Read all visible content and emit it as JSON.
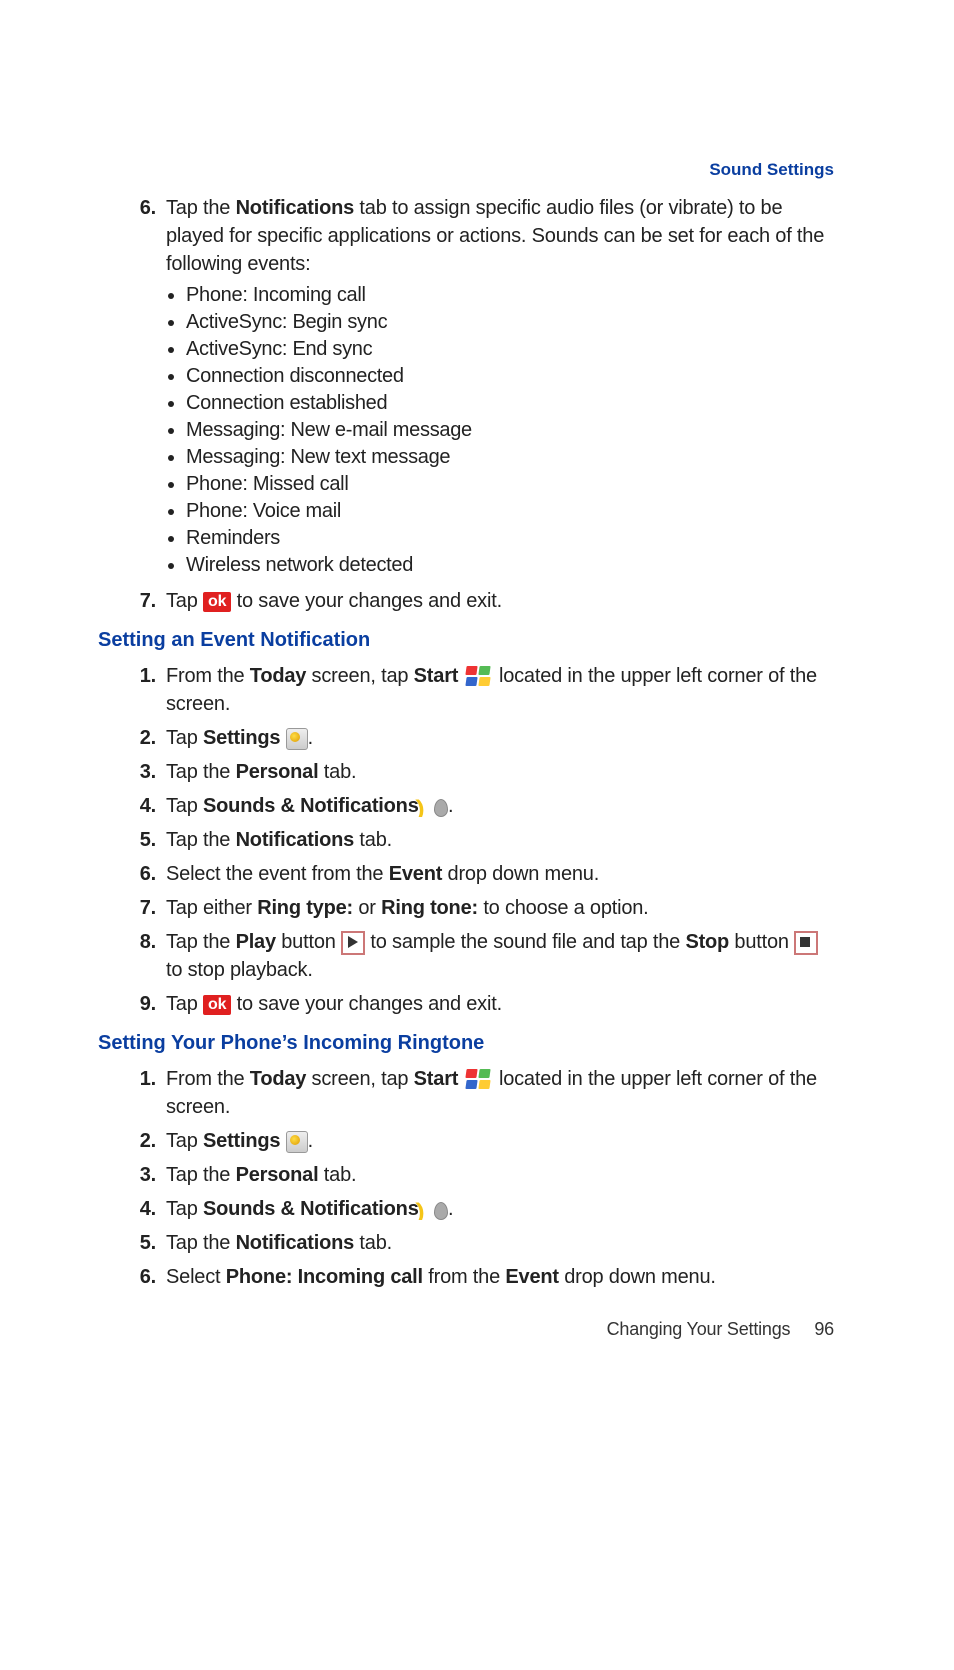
{
  "header": "Sound Settings",
  "top_steps": {
    "s6_num": "6.",
    "s6_part1": "Tap the ",
    "s6_bold1": "Notifications",
    "s6_part2": " tab to assign specific audio files (or vibrate) to be played for specific applications or actions. Sounds can be set for each of the following events:",
    "bullets": [
      "Phone: Incoming call",
      "ActiveSync: Begin sync",
      "ActiveSync: End sync",
      "Connection disconnected",
      "Connection established",
      "Messaging: New e-mail message",
      "Messaging: New text message",
      "Phone: Missed call",
      "Phone: Voice mail",
      "Reminders",
      "Wireless network detected"
    ],
    "s7_num": "7.",
    "s7_part1": "Tap ",
    "s7_ok": "ok",
    "s7_part2": " to save your changes and exit."
  },
  "heading1": "Setting an Event Notification",
  "ev": {
    "s1_num": "1.",
    "s1_a": "From the ",
    "s1_b1": "Today",
    "s1_b": " screen, tap ",
    "s1_b2": "Start",
    "s1_c": " located in the upper left corner of the screen.",
    "s2_num": "2.",
    "s2_a": "Tap ",
    "s2_b": "Settings",
    "s2_c": ".",
    "s3_num": "3.",
    "s3_a": "Tap the ",
    "s3_b": "Personal",
    "s3_c": " tab.",
    "s4_num": "4.",
    "s4_a": "Tap ",
    "s4_b": "Sounds & Notifications",
    "s4_c": ".",
    "s5_num": "5.",
    "s5_a": "Tap the ",
    "s5_b": "Notifications",
    "s5_c": " tab.",
    "s6_num": "6.",
    "s6_a": "Select the event from the ",
    "s6_b": "Event",
    "s6_c": " drop down menu.",
    "s7_num": "7.",
    "s7_a": "Tap either ",
    "s7_b1": "Ring type:",
    "s7_b": " or ",
    "s7_b2": "Ring tone:",
    "s7_c": " to choose a option.",
    "s8_num": "8.",
    "s8_a": " Tap the ",
    "s8_b1": "Play",
    "s8_b": " button ",
    "s8_c": " to sample the sound file and tap the ",
    "s8_b2": "Stop",
    "s8_d": " button ",
    "s8_e": " to stop playback.",
    "s9_num": "9.",
    "s9_a": "Tap ",
    "s9_ok": "ok",
    "s9_b": " to save your changes and exit."
  },
  "heading2": "Setting Your Phone’s Incoming Ringtone",
  "rt": {
    "s1_num": "1.",
    "s1_a": "From the ",
    "s1_b1": "Today",
    "s1_b": " screen, tap ",
    "s1_b2": "Start",
    "s1_c": " located in the upper left corner of the screen.",
    "s2_num": "2.",
    "s2_a": "Tap ",
    "s2_b": "Settings",
    "s2_c": ".",
    "s3_num": "3.",
    "s3_a": "Tap the ",
    "s3_b": "Personal",
    "s3_c": " tab.",
    "s4_num": "4.",
    "s4_a": "Tap ",
    "s4_b": "Sounds & Notifications",
    "s4_c": ".",
    "s5_num": "5.",
    "s5_a": "Tap the ",
    "s5_b": "Notifications",
    "s5_c": " tab.",
    "s6_num": "6.",
    "s6_a": "Select ",
    "s6_b1": "Phone: Incoming call",
    "s6_b": " from the ",
    "s6_b2": "Event",
    "s6_c": " drop down menu."
  },
  "footer_text": "Changing Your Settings",
  "page_num": "96"
}
